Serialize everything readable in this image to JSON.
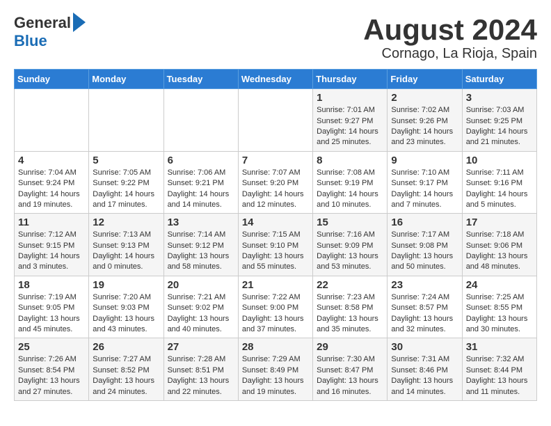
{
  "logo": {
    "general": "General",
    "blue": "Blue"
  },
  "title": "August 2024",
  "subtitle": "Cornago, La Rioja, Spain",
  "days_of_week": [
    "Sunday",
    "Monday",
    "Tuesday",
    "Wednesday",
    "Thursday",
    "Friday",
    "Saturday"
  ],
  "weeks": [
    [
      {
        "num": "",
        "info": ""
      },
      {
        "num": "",
        "info": ""
      },
      {
        "num": "",
        "info": ""
      },
      {
        "num": "",
        "info": ""
      },
      {
        "num": "1",
        "info": "Sunrise: 7:01 AM\nSunset: 9:27 PM\nDaylight: 14 hours\nand 25 minutes."
      },
      {
        "num": "2",
        "info": "Sunrise: 7:02 AM\nSunset: 9:26 PM\nDaylight: 14 hours\nand 23 minutes."
      },
      {
        "num": "3",
        "info": "Sunrise: 7:03 AM\nSunset: 9:25 PM\nDaylight: 14 hours\nand 21 minutes."
      }
    ],
    [
      {
        "num": "4",
        "info": "Sunrise: 7:04 AM\nSunset: 9:24 PM\nDaylight: 14 hours\nand 19 minutes."
      },
      {
        "num": "5",
        "info": "Sunrise: 7:05 AM\nSunset: 9:22 PM\nDaylight: 14 hours\nand 17 minutes."
      },
      {
        "num": "6",
        "info": "Sunrise: 7:06 AM\nSunset: 9:21 PM\nDaylight: 14 hours\nand 14 minutes."
      },
      {
        "num": "7",
        "info": "Sunrise: 7:07 AM\nSunset: 9:20 PM\nDaylight: 14 hours\nand 12 minutes."
      },
      {
        "num": "8",
        "info": "Sunrise: 7:08 AM\nSunset: 9:19 PM\nDaylight: 14 hours\nand 10 minutes."
      },
      {
        "num": "9",
        "info": "Sunrise: 7:10 AM\nSunset: 9:17 PM\nDaylight: 14 hours\nand 7 minutes."
      },
      {
        "num": "10",
        "info": "Sunrise: 7:11 AM\nSunset: 9:16 PM\nDaylight: 14 hours\nand 5 minutes."
      }
    ],
    [
      {
        "num": "11",
        "info": "Sunrise: 7:12 AM\nSunset: 9:15 PM\nDaylight: 14 hours\nand 3 minutes."
      },
      {
        "num": "12",
        "info": "Sunrise: 7:13 AM\nSunset: 9:13 PM\nDaylight: 14 hours\nand 0 minutes."
      },
      {
        "num": "13",
        "info": "Sunrise: 7:14 AM\nSunset: 9:12 PM\nDaylight: 13 hours\nand 58 minutes."
      },
      {
        "num": "14",
        "info": "Sunrise: 7:15 AM\nSunset: 9:10 PM\nDaylight: 13 hours\nand 55 minutes."
      },
      {
        "num": "15",
        "info": "Sunrise: 7:16 AM\nSunset: 9:09 PM\nDaylight: 13 hours\nand 53 minutes."
      },
      {
        "num": "16",
        "info": "Sunrise: 7:17 AM\nSunset: 9:08 PM\nDaylight: 13 hours\nand 50 minutes."
      },
      {
        "num": "17",
        "info": "Sunrise: 7:18 AM\nSunset: 9:06 PM\nDaylight: 13 hours\nand 48 minutes."
      }
    ],
    [
      {
        "num": "18",
        "info": "Sunrise: 7:19 AM\nSunset: 9:05 PM\nDaylight: 13 hours\nand 45 minutes."
      },
      {
        "num": "19",
        "info": "Sunrise: 7:20 AM\nSunset: 9:03 PM\nDaylight: 13 hours\nand 43 minutes."
      },
      {
        "num": "20",
        "info": "Sunrise: 7:21 AM\nSunset: 9:02 PM\nDaylight: 13 hours\nand 40 minutes."
      },
      {
        "num": "21",
        "info": "Sunrise: 7:22 AM\nSunset: 9:00 PM\nDaylight: 13 hours\nand 37 minutes."
      },
      {
        "num": "22",
        "info": "Sunrise: 7:23 AM\nSunset: 8:58 PM\nDaylight: 13 hours\nand 35 minutes."
      },
      {
        "num": "23",
        "info": "Sunrise: 7:24 AM\nSunset: 8:57 PM\nDaylight: 13 hours\nand 32 minutes."
      },
      {
        "num": "24",
        "info": "Sunrise: 7:25 AM\nSunset: 8:55 PM\nDaylight: 13 hours\nand 30 minutes."
      }
    ],
    [
      {
        "num": "25",
        "info": "Sunrise: 7:26 AM\nSunset: 8:54 PM\nDaylight: 13 hours\nand 27 minutes."
      },
      {
        "num": "26",
        "info": "Sunrise: 7:27 AM\nSunset: 8:52 PM\nDaylight: 13 hours\nand 24 minutes."
      },
      {
        "num": "27",
        "info": "Sunrise: 7:28 AM\nSunset: 8:51 PM\nDaylight: 13 hours\nand 22 minutes."
      },
      {
        "num": "28",
        "info": "Sunrise: 7:29 AM\nSunset: 8:49 PM\nDaylight: 13 hours\nand 19 minutes."
      },
      {
        "num": "29",
        "info": "Sunrise: 7:30 AM\nSunset: 8:47 PM\nDaylight: 13 hours\nand 16 minutes."
      },
      {
        "num": "30",
        "info": "Sunrise: 7:31 AM\nSunset: 8:46 PM\nDaylight: 13 hours\nand 14 minutes."
      },
      {
        "num": "31",
        "info": "Sunrise: 7:32 AM\nSunset: 8:44 PM\nDaylight: 13 hours\nand 11 minutes."
      }
    ]
  ]
}
